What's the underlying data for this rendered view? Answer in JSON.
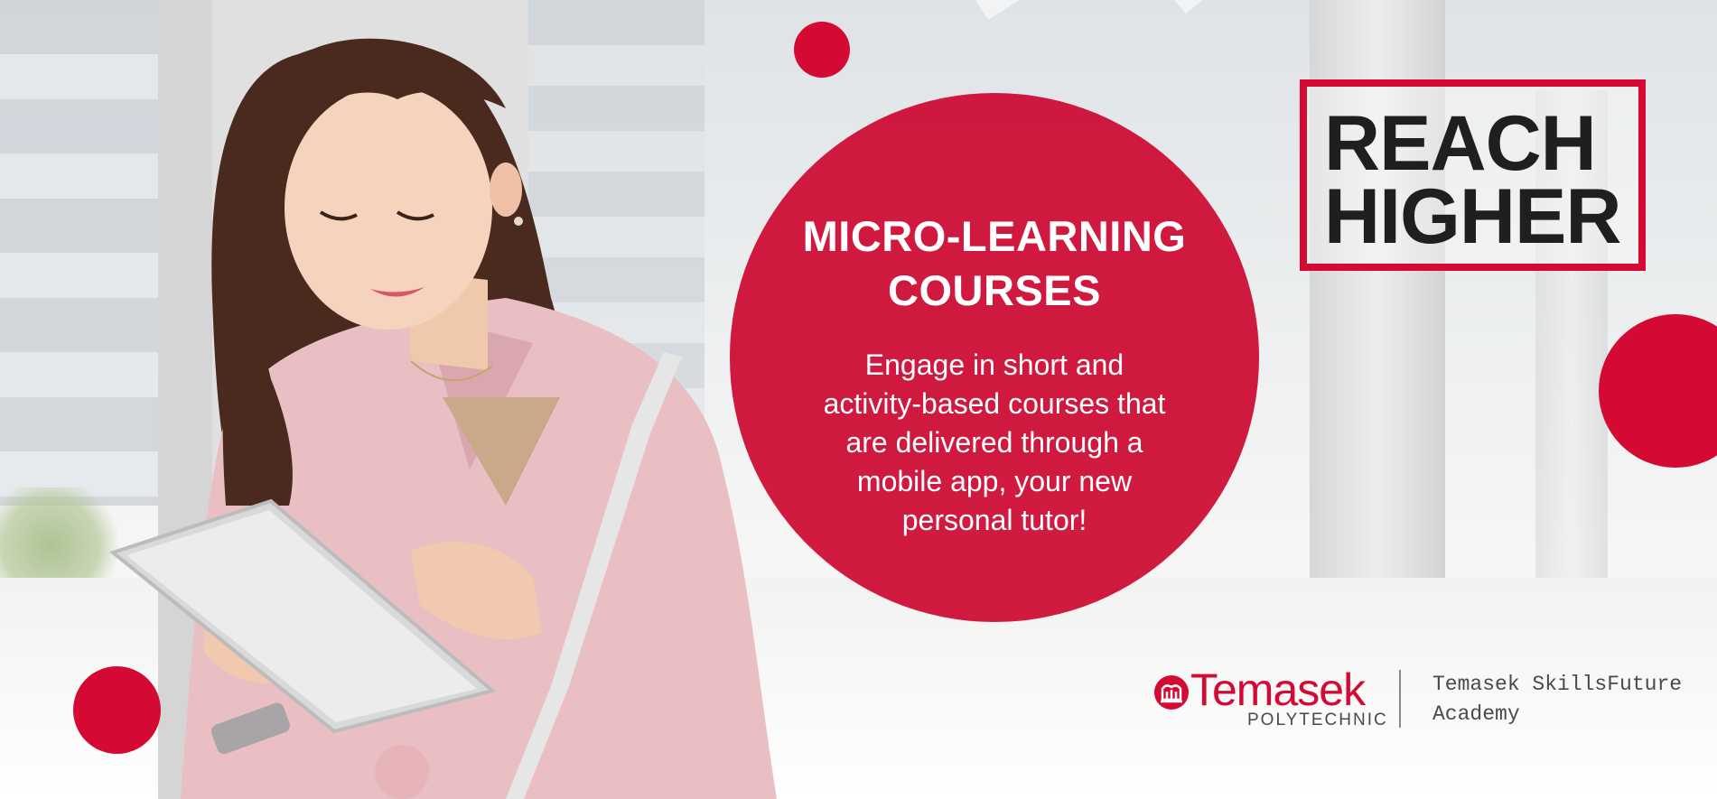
{
  "banner": {
    "headline_line1": "MICRO-LEARNING",
    "headline_line2": "COURSES",
    "body_lines": [
      "Engage in short and",
      "activity-based courses that",
      "are delivered through a",
      "mobile app, your new",
      "personal tutor!"
    ]
  },
  "badge": {
    "line1": "REACH",
    "line2": "HIGHER"
  },
  "logo": {
    "name": "Temasek",
    "subtitle": "POLYTECHNIC",
    "academy_line1": "Temasek SkillsFuture",
    "academy_line2": "Academy"
  },
  "colors": {
    "brand_red": "#d40a34",
    "text_dark": "#1f1f1f",
    "text_grey": "#4a4a4a"
  }
}
